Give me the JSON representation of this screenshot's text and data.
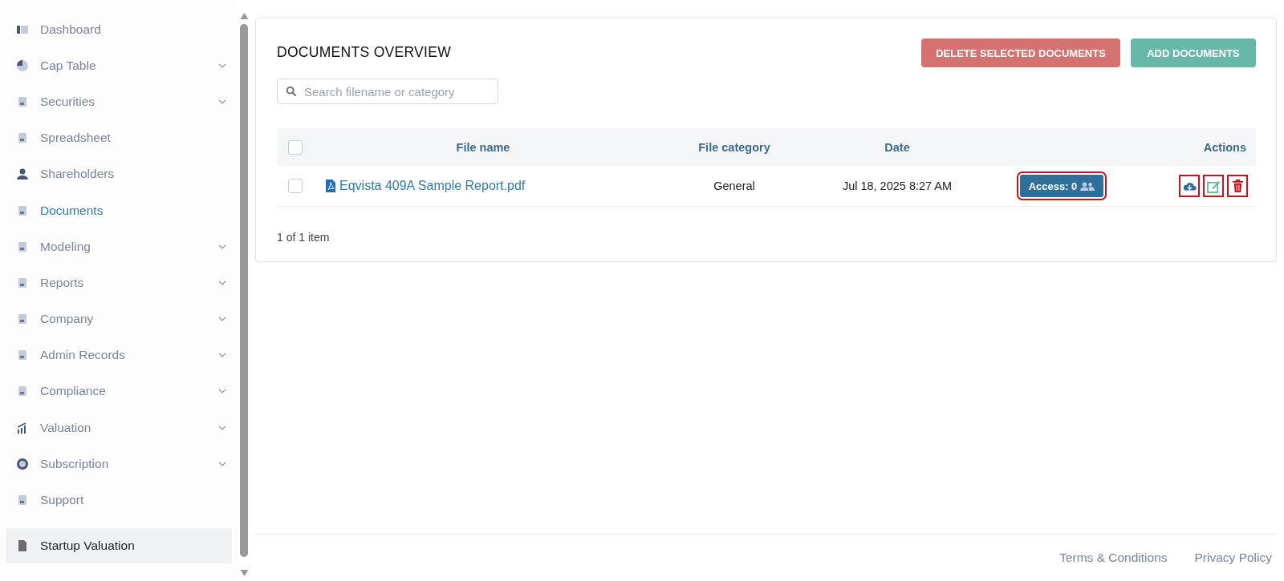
{
  "sidebar": {
    "items": [
      {
        "label": "Dashboard",
        "selected": false,
        "expandable": false
      },
      {
        "label": "Cap Table",
        "selected": false,
        "expandable": true
      },
      {
        "label": "Securities",
        "selected": false,
        "expandable": true
      },
      {
        "label": "Spreadsheet",
        "selected": false,
        "expandable": false
      },
      {
        "label": "Shareholders",
        "selected": false,
        "expandable": false
      },
      {
        "label": "Documents",
        "selected": true,
        "expandable": false
      },
      {
        "label": "Modeling",
        "selected": false,
        "expandable": true
      },
      {
        "label": "Reports",
        "selected": false,
        "expandable": true
      },
      {
        "label": "Company",
        "selected": false,
        "expandable": true
      },
      {
        "label": "Admin Records",
        "selected": false,
        "expandable": true
      },
      {
        "label": "Compliance",
        "selected": false,
        "expandable": true
      },
      {
        "label": "Valuation",
        "selected": false,
        "expandable": true
      },
      {
        "label": "Subscription",
        "selected": false,
        "expandable": true
      },
      {
        "label": "Support",
        "selected": false,
        "expandable": false
      }
    ],
    "bottom_item": {
      "label": "Startup Valuation"
    }
  },
  "panel": {
    "title": "DOCUMENTS OVERVIEW",
    "buttons": [
      {
        "label": "DELETE SELECTED DOCUMENTS",
        "kind": "danger"
      },
      {
        "label": "ADD DOCUMENTS",
        "kind": "primary"
      }
    ],
    "search": {
      "placeholder": "Search filename or category"
    },
    "table": {
      "select_all": {
        "checked": false
      },
      "columns": [
        "File name",
        "File category",
        "Date",
        "Actions"
      ],
      "rows": [
        {
          "checked": false,
          "file_name": "Eqvista 409A Sample Report.pdf",
          "category": "General",
          "date": "Jul 18, 2025 8:27 AM",
          "access": {
            "label": "Access: 0",
            "highlighted": true
          },
          "actions": [
            {
              "kind": "download",
              "highlighted": true
            },
            {
              "kind": "edit",
              "highlighted": true
            },
            {
              "kind": "delete",
              "highlighted": true
            }
          ]
        }
      ]
    },
    "pager": "1 of 1 item"
  },
  "footer": {
    "links": [
      "Terms & Conditions",
      "Privacy Policy"
    ]
  }
}
